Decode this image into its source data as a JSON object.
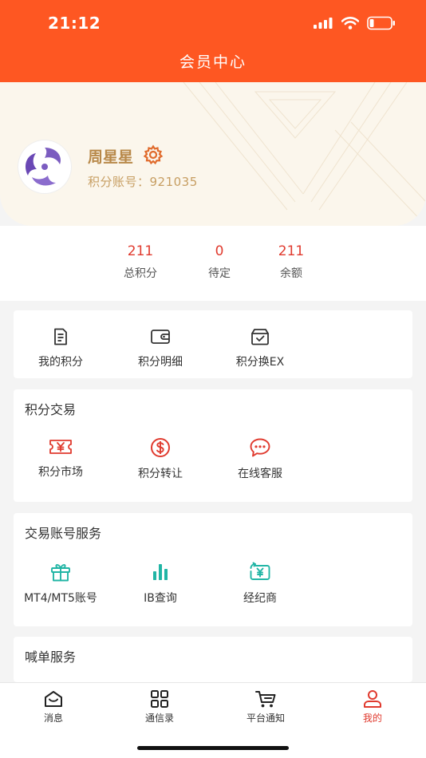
{
  "status": {
    "time": "21:12"
  },
  "header": {
    "title": "会员中心"
  },
  "profile": {
    "name": "周星星",
    "account": "积分账号：921035"
  },
  "stats": [
    {
      "value": "211",
      "label": "总积分"
    },
    {
      "value": "0",
      "label": "待定"
    },
    {
      "value": "211",
      "label": "余额"
    }
  ],
  "quick_menu": [
    {
      "label": "我的积分",
      "icon": "document-icon"
    },
    {
      "label": "积分明细",
      "icon": "wallet-icon"
    },
    {
      "label": "积分换EX",
      "icon": "exchange-box-icon"
    }
  ],
  "points_trade": {
    "title": "积分交易",
    "items": [
      {
        "label": "积分市场",
        "icon": "ticket-yen-icon"
      },
      {
        "label": "积分转让",
        "icon": "dollar-coin-icon"
      },
      {
        "label": "在线客服",
        "icon": "chat-icon"
      }
    ]
  },
  "account_services": {
    "title": "交易账号服务",
    "items": [
      {
        "label": "MT4/MT5账号",
        "icon": "gift-icon"
      },
      {
        "label": "IB查询",
        "icon": "bar-chart-icon"
      },
      {
        "label": "经纪商",
        "icon": "yen-card-icon"
      }
    ]
  },
  "signal_services": {
    "title": "喊单服务"
  },
  "tabbar": [
    {
      "label": "消息",
      "icon": "inbox-icon"
    },
    {
      "label": "通信录",
      "icon": "grid-icon"
    },
    {
      "label": "平台通知",
      "icon": "cart-icon"
    },
    {
      "label": "我的",
      "icon": "person-icon",
      "active": true
    }
  ],
  "colors": {
    "brand": "#fe5722",
    "accent_red": "#e03a2e",
    "gold": "#b8894a",
    "teal": "#21b5a5"
  }
}
